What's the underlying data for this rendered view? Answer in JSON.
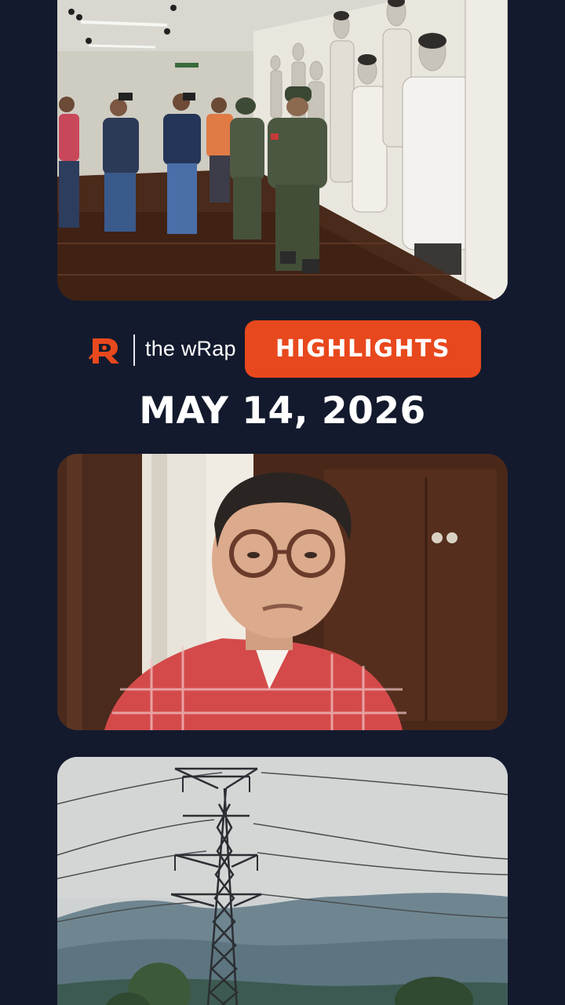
{
  "brand": {
    "name": "the wRap",
    "logo_icon": "rappler-r-logo-icon",
    "accent_color": "#e8481d"
  },
  "badge": {
    "label": "HIGHLIGHTS"
  },
  "date": "MAY 14, 2026",
  "stories": [
    {
      "image": "soldiers-walking-gallery-photo"
    },
    {
      "image": "man-in-plaid-shirt-video-photo"
    },
    {
      "image": "power-transmission-tower-photo"
    }
  ]
}
